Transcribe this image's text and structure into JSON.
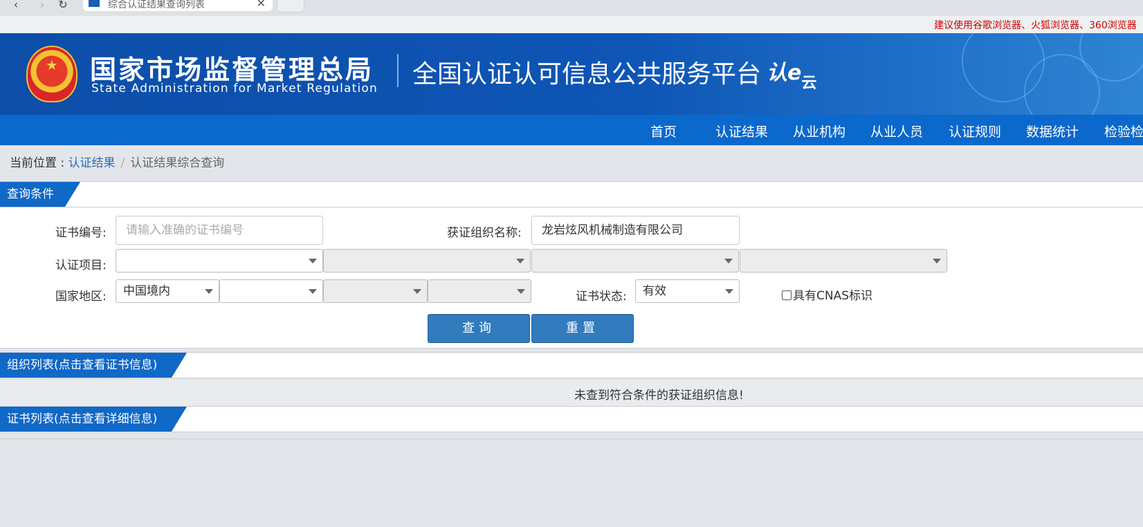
{
  "browser": {
    "tab_title": "综合认证结果查询列表",
    "close_glyph": "✕",
    "back_glyph": "‹",
    "forward_glyph": "›",
    "reload_glyph": "↻"
  },
  "notice": "建议使用谷歌浏览器、火狐浏览器、360浏览器",
  "banner": {
    "agency_cn": "国家市场监督管理总局",
    "agency_en": "State Administration  for  Market Regulation",
    "platform_title": "全国认证认可信息公共服务平台",
    "logo_main": "认e",
    "logo_sub": "云"
  },
  "nav": {
    "items": [
      "首页",
      "认证结果",
      "从业机构",
      "从业人员",
      "认证规则",
      "数据统计",
      "检验检测"
    ]
  },
  "breadcrumb": {
    "prefix": "当前位置 : ",
    "link": "认证结果",
    "separator": "/",
    "current": "认证结果综合查询"
  },
  "query_panel": {
    "title": "查询条件",
    "cert_no_label": "证书编号:",
    "cert_no_placeholder": "请输入准确的证书编号",
    "org_name_label": "获证组织名称:",
    "org_name_value": "龙岩炫风机械制造有限公司",
    "cert_item_label": "认证项目:",
    "cert_item_selects": [
      "",
      "",
      "",
      ""
    ],
    "region_label": "国家地区:",
    "region_selects": [
      "中国境内",
      "",
      "",
      ""
    ],
    "status_label": "证书状态:",
    "status_value": "有效",
    "cnas_label": "具有CNAS标识",
    "cnas_checked": false,
    "search_button": "查询",
    "reset_button": "重置"
  },
  "org_list": {
    "title": "组织列表(点击查看证书信息)",
    "empty_message": "未查到符合条件的获证组织信息!"
  },
  "cert_list": {
    "title": "证书列表(点击查看详细信息)"
  },
  "colors": {
    "banner_blue": "#0e55b5",
    "nav_blue": "#0b68cc",
    "section_blue": "#1068c7",
    "button_blue": "#327bbd",
    "notice_red": "#cc0000",
    "link_blue": "#2a6dbb"
  }
}
